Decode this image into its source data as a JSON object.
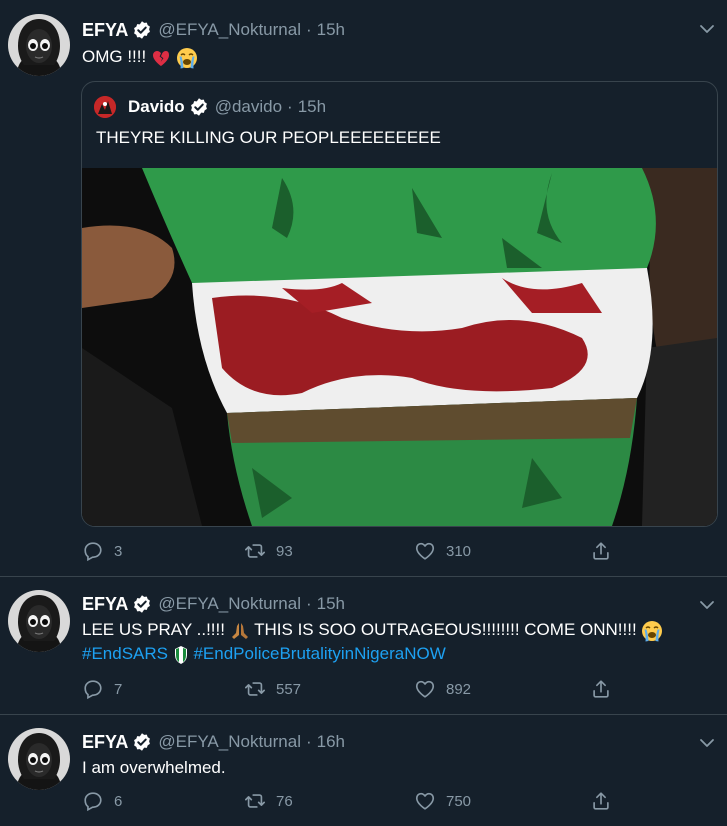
{
  "tweets": [
    {
      "name": "EFYA",
      "handle": "@EFYA_Nokturnal",
      "time": "15h",
      "text": "OMG !!!! ",
      "emojis": [
        "broken-heart-emoji",
        "crying-face-emoji"
      ],
      "quoted": {
        "name": "Davido",
        "handle": "@davido",
        "time": "15h",
        "text": "THEYRE KILLING OUR PEOPLEEEEEEEEE",
        "media": "blood-stained-nigerian-flag-photo"
      },
      "replies": "3",
      "retweets": "93",
      "likes": "310"
    },
    {
      "name": "EFYA",
      "handle": "@EFYA_Nokturnal",
      "time": "15h",
      "text_part1": "LEE US PRAY ..!!!! ",
      "text_part2": " THIS IS SOO OUTRAGEOUS!!!!!!!! COME ONN!!!! ",
      "hashtag1": "#EndSARS",
      "hashtag2": "#EndPoliceBrutalityinNigeraNOW",
      "replies": "7",
      "retweets": "557",
      "likes": "892"
    },
    {
      "name": "EFYA",
      "handle": "@EFYA_Nokturnal",
      "time": "16h",
      "text": "I am overwhelmed.",
      "replies": "6",
      "retweets": "76",
      "likes": "750"
    }
  ],
  "colors": {
    "background": "#15202b",
    "secondary_text": "#8899a6",
    "link": "#1da1f2",
    "divider": "#38444d"
  }
}
